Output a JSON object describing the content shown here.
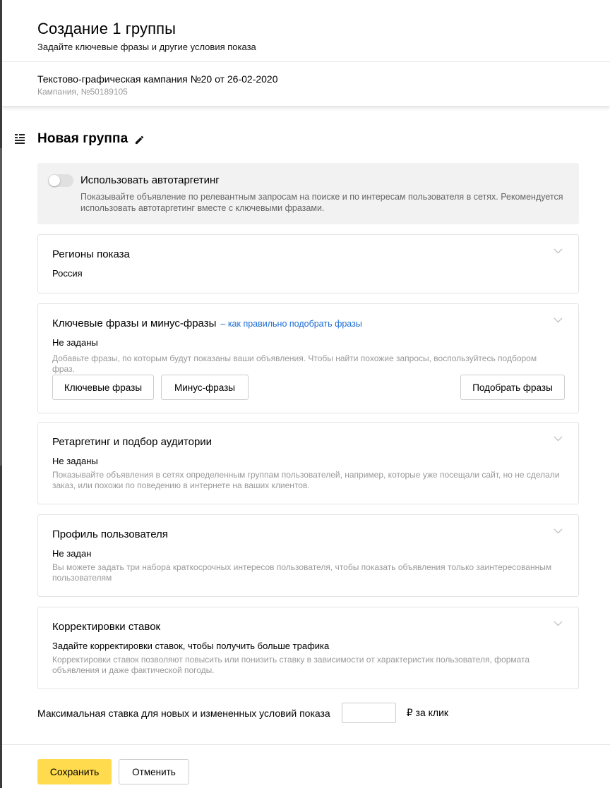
{
  "header": {
    "title": "Создание 1 группы",
    "subtitle": "Задайте ключевые фразы и другие условия показа"
  },
  "campaign": {
    "name": "Текстово-графическая кампания №20 от 26-02-2020",
    "id_label": "Кампания, №50189105"
  },
  "group": {
    "title": "Новая группа",
    "icons": [
      "list-icon",
      "pencil-icon"
    ]
  },
  "autotargeting": {
    "label": "Использовать автотаргетинг",
    "enabled": false,
    "description": "Показывайте объявление по релевантным запросам на поиске и по интересам пользователя в сетях. Рекомендуется использовать автотаргетинг вместе с ключевыми фразами."
  },
  "regions": {
    "title": "Регионы показа",
    "value": "Россия"
  },
  "keywords": {
    "title": "Ключевые фразы и минус-фразы",
    "help_link": "– как правильно подобрать фразы",
    "value": "Не заданы",
    "description": "Добавьте фразы, по которым будут показаны ваши объявления. Чтобы найти похожие запросы, воспользуйтесь подбором фраз.",
    "buttons": {
      "keywords": "Ключевые фразы",
      "minus": "Минус-фразы",
      "pick": "Подобрать фразы"
    }
  },
  "retargeting": {
    "title": "Ретаргетинг и подбор аудитории",
    "value": "Не заданы",
    "description": "Показывайте объявления в сетях определенным группам пользователей, например, которые уже посещали сайт, но не сделали заказ, или похожи по поведению в интернете на ваших клиентов."
  },
  "profile": {
    "title": "Профиль пользователя",
    "value": "Не задан",
    "description": "Вы можете задать три набора краткосрочных интересов пользователя, чтобы показать объявления только заинтересованным пользователям"
  },
  "bid_adjustments": {
    "title": "Корректировки ставок",
    "value": "Задайте корректировки ставок, чтобы получить больше трафика",
    "description": "Корректировки ставок позволяют повысить или понизить ставку в зависимости от характеристик пользователя, формата объявления и даже фактической погоды."
  },
  "max_bid": {
    "label": "Максимальная ставка для новых и измененных условий показа",
    "value": "",
    "unit": "₽ за клик"
  },
  "footer": {
    "save": "Сохранить",
    "cancel": "Отменить"
  },
  "colors": {
    "save_button": "#ffdb4d",
    "link": "#1a6bd1",
    "autotarget_bg": "#f2f2f2"
  }
}
